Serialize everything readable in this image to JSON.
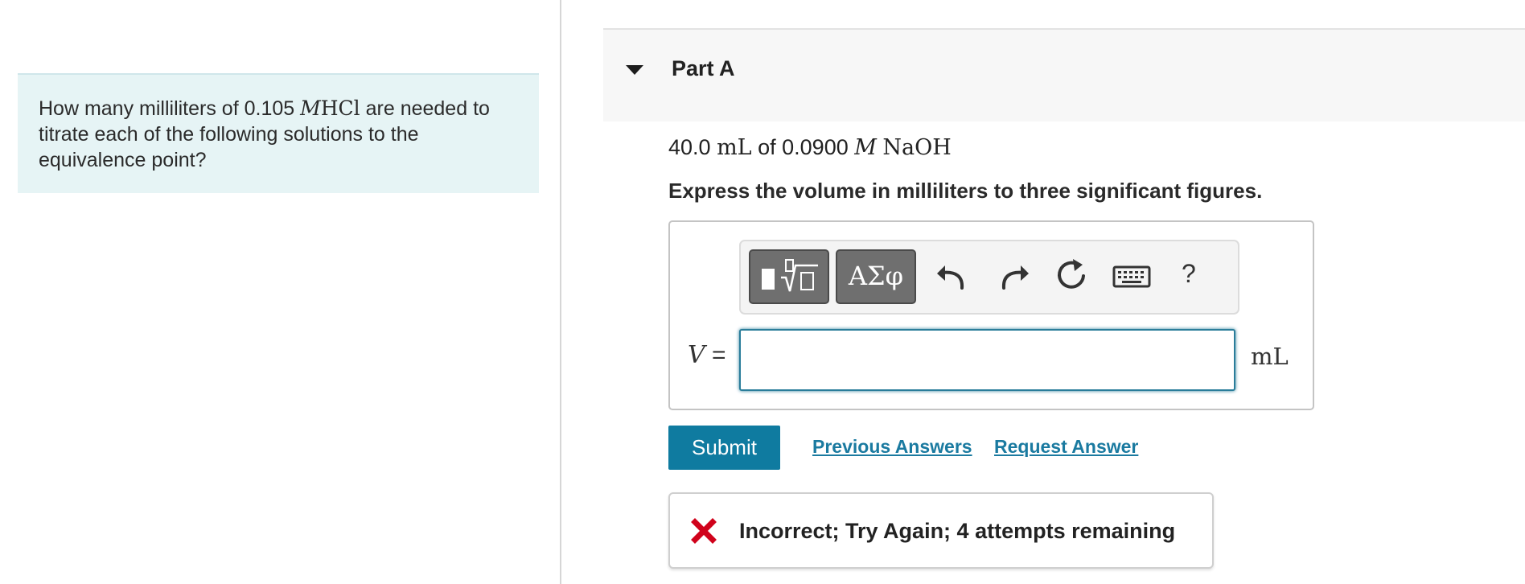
{
  "problem": {
    "text_before": "How many milliliters of 0.105 ",
    "var_M": "M",
    "formula": "HCl",
    "text_after": " are needed to titrate each of the following solutions to the equivalence point?"
  },
  "part": {
    "title": "Part A"
  },
  "question": {
    "volume": "40.0",
    "unit": "mL",
    "of": " of 0.0900 ",
    "var_M": "M",
    "formula": "NaOH"
  },
  "instruction": "Express the volume in milliliters to three significant figures.",
  "toolbar": {
    "symbols_label": "ΑΣφ",
    "help_label": "?"
  },
  "answer": {
    "variable": "V",
    "equals": " =",
    "value": "",
    "unit": "mL"
  },
  "actions": {
    "submit": "Submit",
    "previous_answers": "Previous Answers",
    "request_answer": "Request Answer"
  },
  "feedback": {
    "message": "Incorrect; Try Again; 4 attempts remaining",
    "icon": "x-icon",
    "color": "#d0021b"
  },
  "colors": {
    "accent": "#0f7ba0",
    "link": "#1a7aa0",
    "prompt_bg": "#e6f4f5"
  }
}
